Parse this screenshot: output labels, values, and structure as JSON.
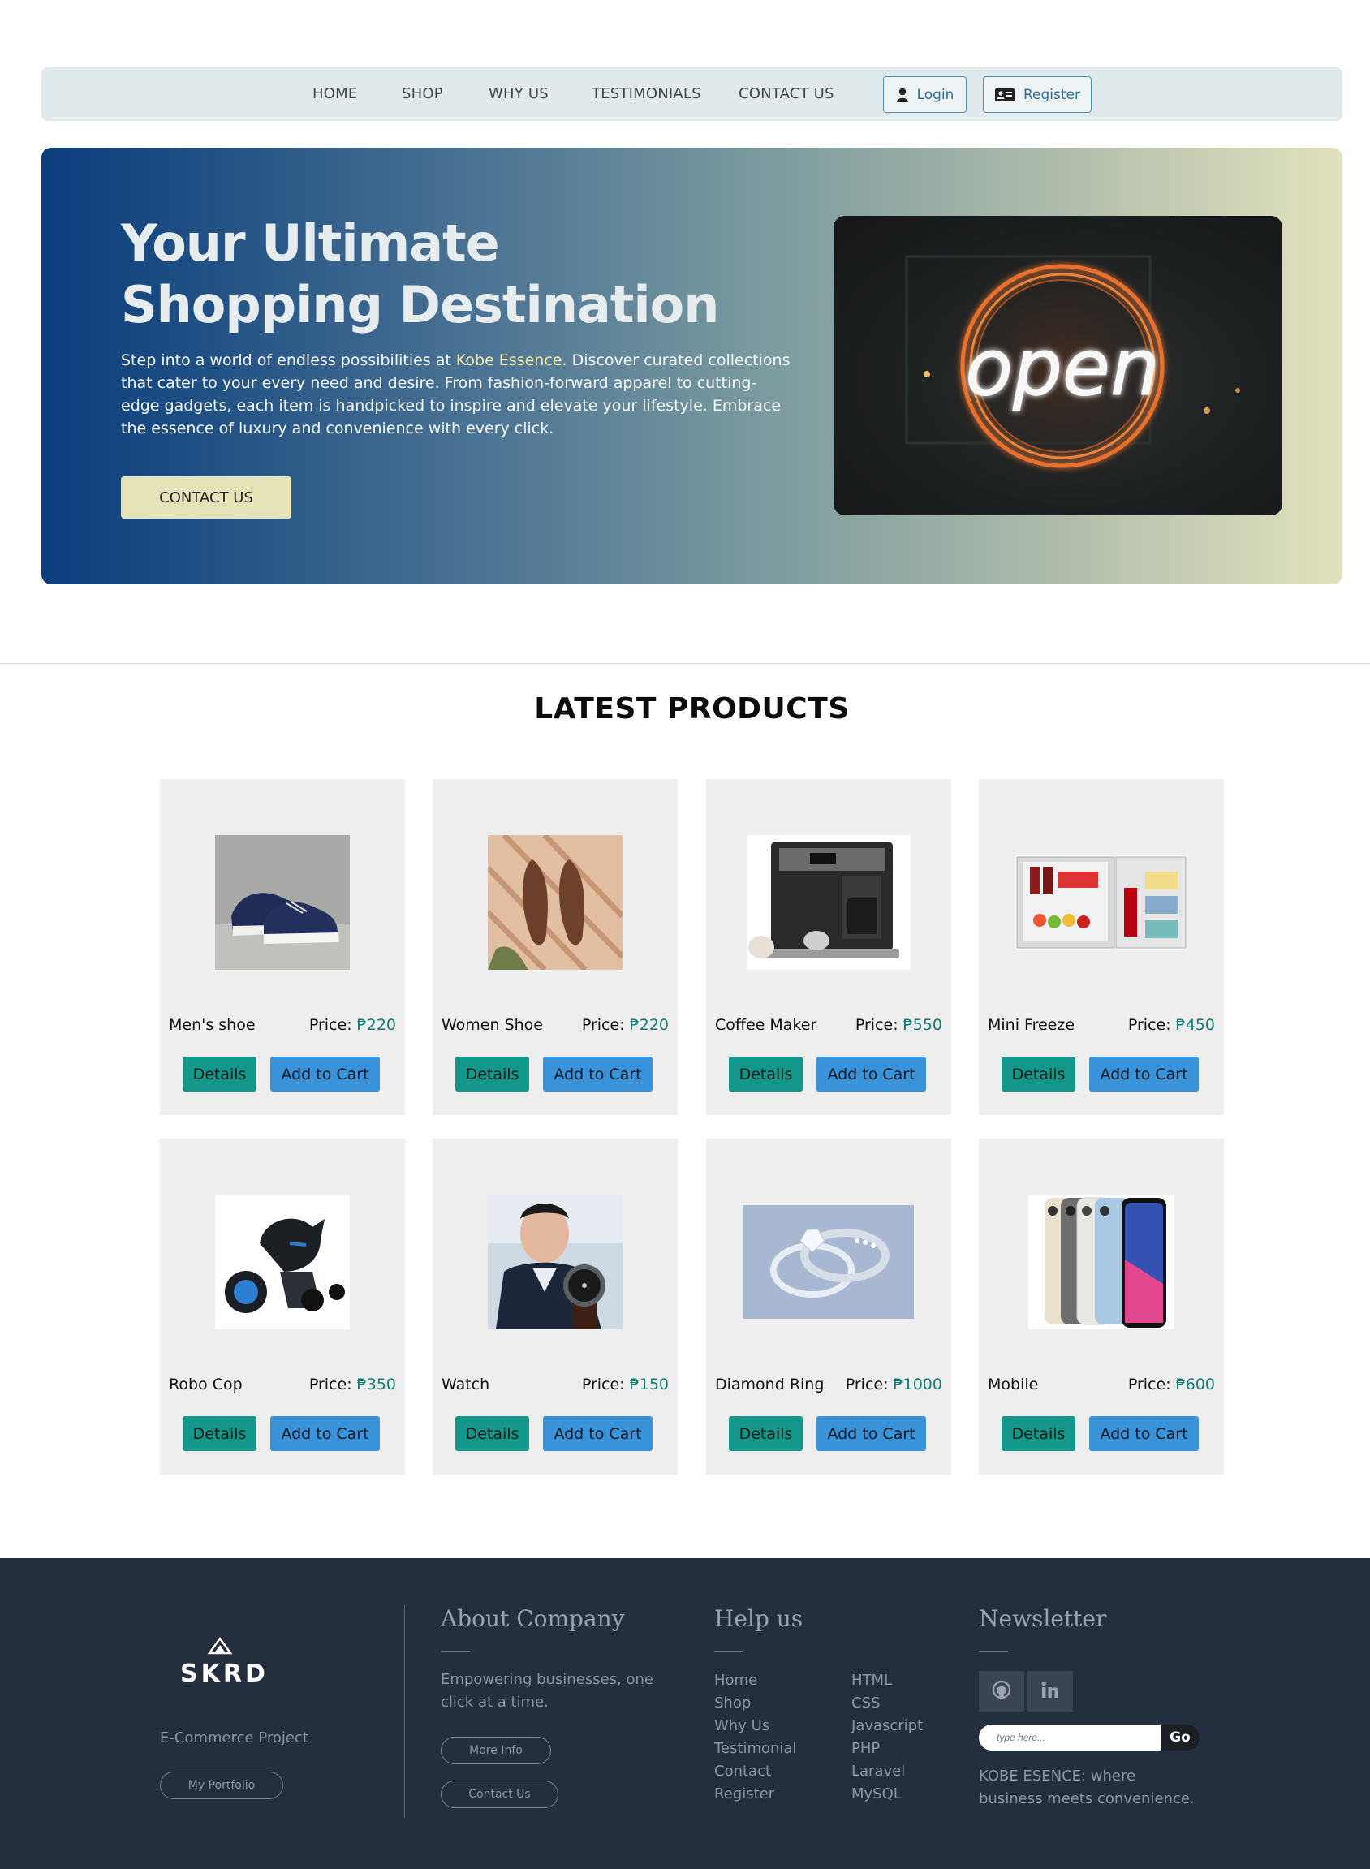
{
  "nav": {
    "links": [
      "HOME",
      "SHOP",
      "WHY US",
      "TESTIMONIALS",
      "CONTACT US"
    ],
    "login_label": "Login",
    "register_label": "Register"
  },
  "hero": {
    "title_line1": "Your Ultimate",
    "title_line2": "Shopping Destination",
    "text_before": "Step into a world of endless possibilities at ",
    "brand": "Kobe Essence",
    "text_after": ". Discover curated collections that cater to your every need and desire. From fashion-forward apparel to cutting-edge gadgets, each item is handpicked to inspire and elevate your lifestyle. Embrace the essence of luxury and convenience with every click.",
    "button_label": "CONTACT US",
    "image_sign_text": "open"
  },
  "products": {
    "title": "LATEST PRODUCTS",
    "price_prefix": "Price: ",
    "details_label": "Details",
    "cart_label": "Add to Cart",
    "items": [
      {
        "name": "Men's shoe",
        "price": "₱220",
        "icon": "shoe-image"
      },
      {
        "name": "Women Shoe",
        "price": "₱220",
        "icon": "flats-image"
      },
      {
        "name": "Coffee Maker",
        "price": "₱550",
        "icon": "coffee-maker-image"
      },
      {
        "name": "Mini Freeze",
        "price": "₱450",
        "icon": "mini-fridge-image"
      },
      {
        "name": "Robo Cop",
        "price": "₱350",
        "icon": "robot-toy-image"
      },
      {
        "name": "Watch",
        "price": "₱150",
        "icon": "watch-image"
      },
      {
        "name": "Diamond Ring",
        "price": "₱1000",
        "icon": "ring-image"
      },
      {
        "name": "Mobile",
        "price": "₱600",
        "icon": "phone-image"
      }
    ]
  },
  "footer": {
    "logo_text": "SKRD",
    "project_label": "E-Commerce Project",
    "portfolio_label": "My Portfolio",
    "about": {
      "heading": "About Company",
      "text": "Empowering businesses, one click at a time.",
      "more_info_label": "More Info",
      "contact_label": "Contact Us"
    },
    "help": {
      "heading": "Help us",
      "col1": [
        "Home",
        "Shop",
        "Why Us",
        "Testimonial",
        "Contact",
        "Register"
      ],
      "col2": [
        "HTML",
        "CSS",
        "Javascript",
        "PHP",
        "Laravel",
        "MySQL"
      ]
    },
    "newsletter": {
      "heading": "Newsletter",
      "placeholder": "type here...",
      "go_label": "Go",
      "tagline": "KOBE ESENCE: where business meets convenience."
    }
  }
}
